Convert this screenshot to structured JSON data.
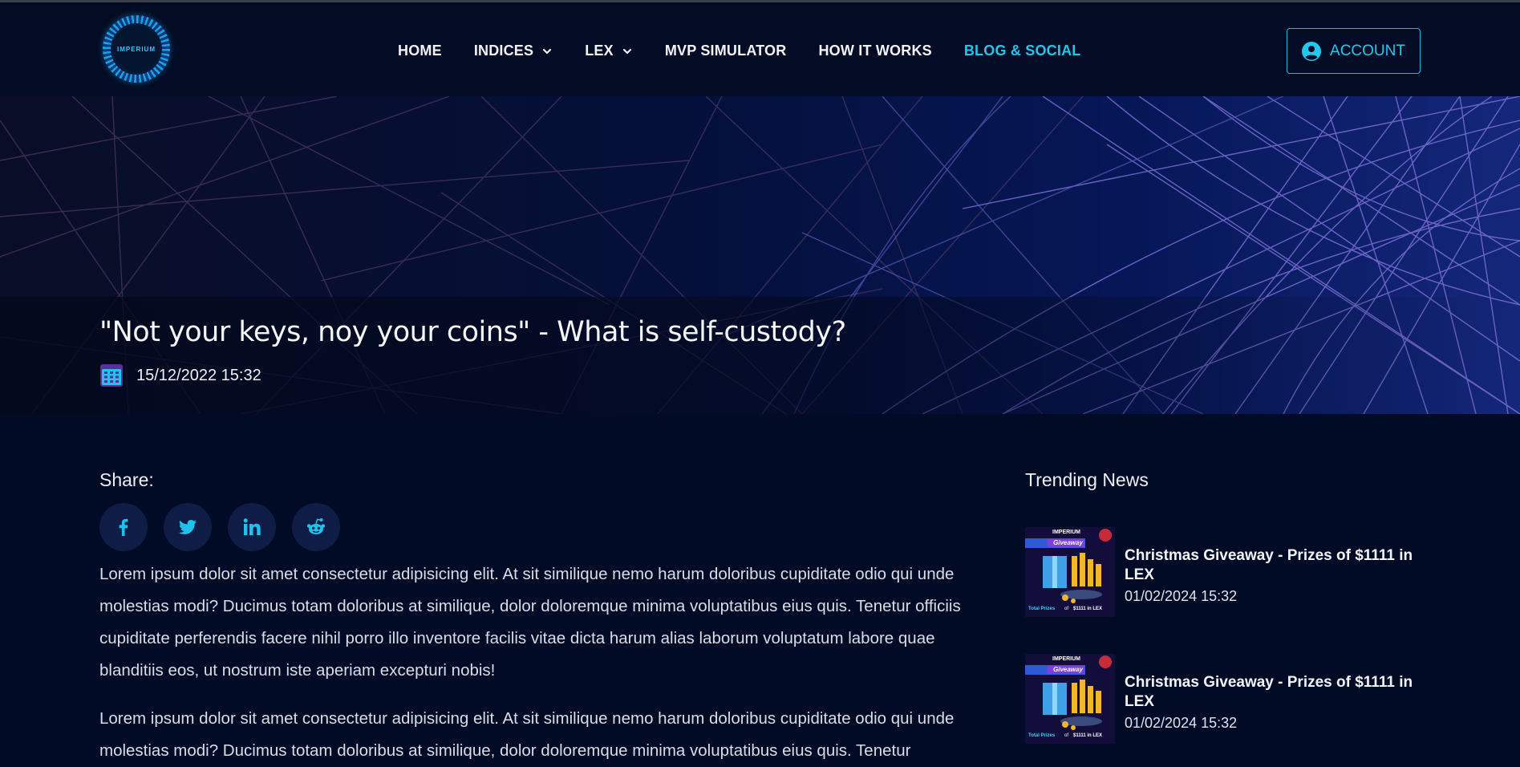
{
  "nav": {
    "logo_text": "IMPERIUM",
    "items": [
      {
        "label": "HOME",
        "has_dropdown": false,
        "active": false
      },
      {
        "label": "INDICES",
        "has_dropdown": true,
        "active": false
      },
      {
        "label": "LEX",
        "has_dropdown": true,
        "active": false
      },
      {
        "label": "MVP SIMULATOR",
        "has_dropdown": false,
        "active": false
      },
      {
        "label": "HOW IT WORKS",
        "has_dropdown": false,
        "active": false
      },
      {
        "label": "BLOG & SOCIAL",
        "has_dropdown": false,
        "active": true
      }
    ],
    "account_label": "ACCOUNT"
  },
  "post": {
    "title": "\"Not your keys, noy your coins\" - What is self-custody?",
    "date": "15/12/2022 15:32"
  },
  "share": {
    "label": "Share:",
    "networks": [
      "facebook-icon",
      "twitter-icon",
      "linkedin-icon",
      "reddit-icon"
    ]
  },
  "body": {
    "paragraphs": [
      "Lorem ipsum dolor sit amet consectetur adipisicing elit. At sit similique nemo harum doloribus cupiditate odio qui unde molestias modi? Ducimus totam doloribus at similique, dolor doloremque minima voluptatibus eius quis. Tenetur officiis cupiditate perferendis facere nihil porro illo inventore facilis vitae dicta harum alias laborum voluptatum labore quae blanditiis eos, ut nostrum iste aperiam excepturi nobis!",
      "Lorem ipsum dolor sit amet consectetur adipisicing elit. At sit similique nemo harum doloribus cupiditate odio qui unde molestias modi? Ducimus totam doloribus at similique, dolor doloremque minima voluptatibus eius quis. Tenetur"
    ]
  },
  "trending": {
    "title": "Trending News",
    "items": [
      {
        "title": "Christmas Giveaway - Prizes of $1111 in LEX",
        "date": "01/02/2024 15:32",
        "thumb": {
          "brand": "IMPERIUM",
          "badge": "Giveaway",
          "caption_pre": "Total Prizes",
          "caption_mid": "of",
          "caption_post": "$1111 in LEX"
        }
      },
      {
        "title": "Christmas Giveaway - Prizes of $1111 in LEX",
        "date": "01/02/2024 15:32",
        "thumb": {
          "brand": "IMPERIUM",
          "badge": "Giveaway",
          "caption_pre": "Total Prizes",
          "caption_mid": "of",
          "caption_post": "$1111 in LEX"
        }
      }
    ]
  },
  "colors": {
    "background": "#020b25",
    "accent": "#21c6ea",
    "hero_lines": "#7b6fd6"
  }
}
